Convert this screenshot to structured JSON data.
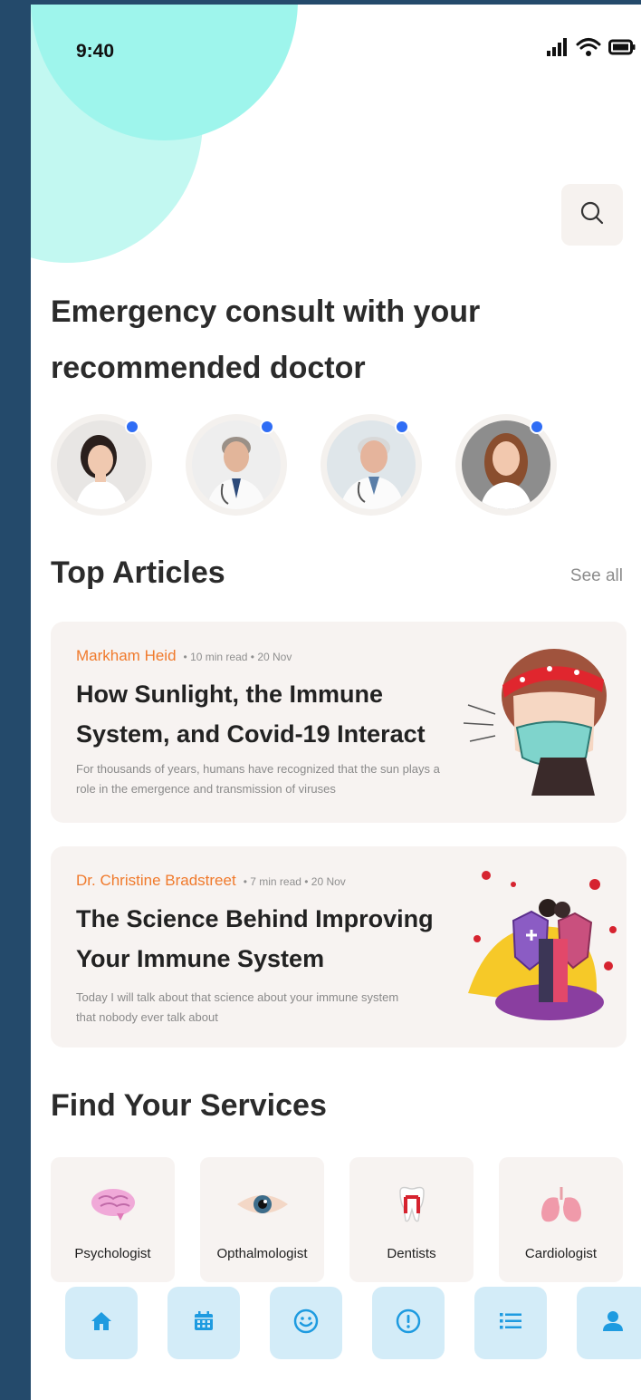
{
  "status_bar": {
    "time": "9:40"
  },
  "headline": "Emergency consult with your recommended doctor",
  "doctors": [
    {
      "name": "doctor-1",
      "online": true
    },
    {
      "name": "doctor-2",
      "online": true
    },
    {
      "name": "doctor-3",
      "online": true
    },
    {
      "name": "doctor-4",
      "online": true
    }
  ],
  "articles_section": {
    "title": "Top Articles",
    "see_all": "See all"
  },
  "articles": [
    {
      "author": "Markham Heid",
      "info": "• 10 min read • 20 Nov",
      "title": "How Sunlight, the Immune System, and Covid-19 Interact",
      "desc": "For thousands of years, humans have recognized that the sun plays a role in the emergence and transmission of viruses"
    },
    {
      "author": "Dr. Christine Bradstreet",
      "info": "• 7 min read • 20 Nov",
      "title": "The Science Behind Improving Your Immune System",
      "desc": "Today I will talk about that science about your immune system that nobody ever talk about"
    }
  ],
  "services_section": {
    "title": "Find Your Services"
  },
  "services": [
    {
      "label": "Psychologist",
      "icon": "brain-icon"
    },
    {
      "label": "Opthalmologist",
      "icon": "eye-icon"
    },
    {
      "label": "Dentists",
      "icon": "tooth-icon"
    },
    {
      "label": "Cardiologist",
      "icon": "lungs-icon"
    }
  ],
  "nav": [
    {
      "icon": "home-icon"
    },
    {
      "icon": "calendar-icon"
    },
    {
      "icon": "smiley-icon"
    },
    {
      "icon": "alert-icon"
    },
    {
      "icon": "list-icon"
    },
    {
      "icon": "user-icon"
    }
  ],
  "colors": {
    "accent_blue": "#2f6df5",
    "author_orange": "#f07a2c",
    "nav_bg": "#d3ecf8",
    "nav_icon": "#1e9be0",
    "blob": "#9ef5ec"
  }
}
